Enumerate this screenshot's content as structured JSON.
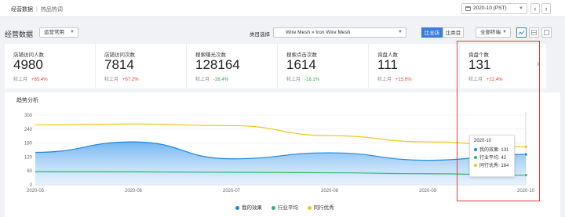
{
  "breadcrumb": {
    "root": "经营数据",
    "current": "热品热词"
  },
  "date_picker": {
    "value": "2020-10 (PST)"
  },
  "nav": {
    "prev": "‹",
    "next": "›"
  },
  "section_title": "经营数据",
  "scope_select": {
    "value": "运营常用"
  },
  "category": {
    "label": "类目选择",
    "value": "Wire Mesh » Iron Wire Mesh"
  },
  "compare": {
    "peer": "比全店",
    "category": "比类目"
  },
  "terminal_select": {
    "value": "全部终端"
  },
  "metrics": [
    {
      "label": "店铺访问人数",
      "value": "4980",
      "compare_label": "较上月",
      "change": "+85.4%",
      "dir": "up"
    },
    {
      "label": "店铺访问次数",
      "value": "7814",
      "compare_label": "较上月",
      "change": "+67.2%",
      "dir": "up"
    },
    {
      "label": "搜索曝光次数",
      "value": "128164",
      "compare_label": "较上月",
      "change": "-28.4%",
      "dir": "down"
    },
    {
      "label": "搜索点击次数",
      "value": "1614",
      "compare_label": "较上月",
      "change": "-18.1%",
      "dir": "down"
    },
    {
      "label": "询盘人数",
      "value": "111",
      "compare_label": "较上月",
      "change": "+15.6%",
      "dir": "up"
    },
    {
      "label": "询盘个数",
      "value": "131",
      "compare_label": "较上月",
      "change": "+22.4%",
      "dir": "up"
    }
  ],
  "chart_title": "趋势分析",
  "tooltip": {
    "date": "2020-10",
    "rows": [
      {
        "name": "我的效果",
        "value": "131"
      },
      {
        "name": "行业平均",
        "value": "42"
      },
      {
        "name": "同行优秀",
        "value": "164"
      }
    ]
  },
  "chart_data": {
    "type": "area",
    "x": [
      "2020-05",
      "2020-06",
      "2020-07",
      "2020-08",
      "2020-09",
      "2020-10"
    ],
    "ylim": [
      0,
      300
    ],
    "yticks": [
      0,
      60,
      120,
      180,
      240,
      300
    ],
    "grid": true,
    "legend": "bottom",
    "series": [
      {
        "name": "我的效果",
        "color": "#1e88e5",
        "values": [
          140,
          185,
          112,
          138,
          106,
          131
        ]
      },
      {
        "name": "行业平均",
        "color": "#2fb86a",
        "values": [
          57,
          56,
          54,
          52,
          48,
          42
        ]
      },
      {
        "name": "同行优秀",
        "color": "#f5c518",
        "values": [
          258,
          262,
          255,
          212,
          185,
          164
        ]
      }
    ]
  },
  "colors": {
    "accent": "#3a7ce0",
    "highlight_box": "#e23b3b",
    "up": "#e8453c",
    "down": "#2fa84f"
  },
  "icons": [
    "calendar-icon",
    "chevron-down-icon",
    "line-chart-icon",
    "table-icon",
    "download-icon",
    "chevron-right-icon"
  ]
}
